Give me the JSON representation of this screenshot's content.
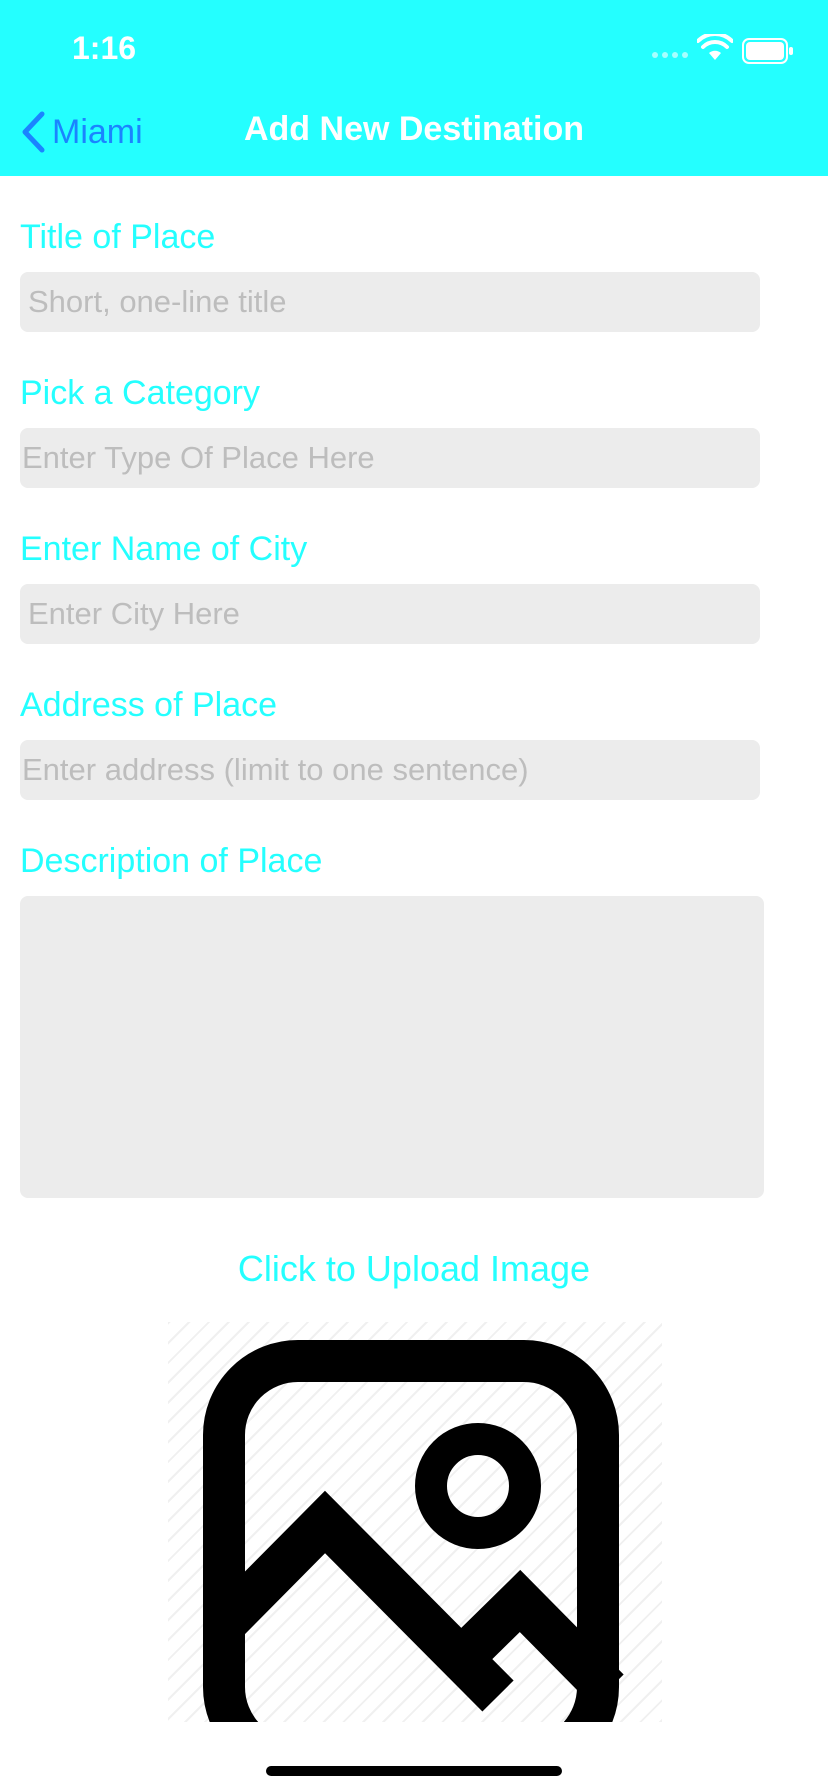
{
  "status_bar": {
    "time": "1:16"
  },
  "nav": {
    "back_label": "Miami",
    "title": "Add New Destination"
  },
  "form": {
    "title_label": "Title of Place",
    "title_placeholder": "Short, one-line title",
    "category_label": "Pick a Category",
    "category_placeholder": "Enter Type Of Place Here",
    "city_label": "Enter Name of City",
    "city_placeholder": "Enter City Here",
    "address_label": "Address of Place",
    "address_placeholder": "Enter address (limit to one sentence)",
    "description_label": "Description of Place"
  },
  "upload": {
    "label": "Click to Upload Image",
    "icon": "image-icon"
  },
  "colors": {
    "accent": "#24FFFF",
    "back_link": "#1A84FF",
    "field_bg": "#ECECEC",
    "placeholder": "#BDBDBD"
  }
}
